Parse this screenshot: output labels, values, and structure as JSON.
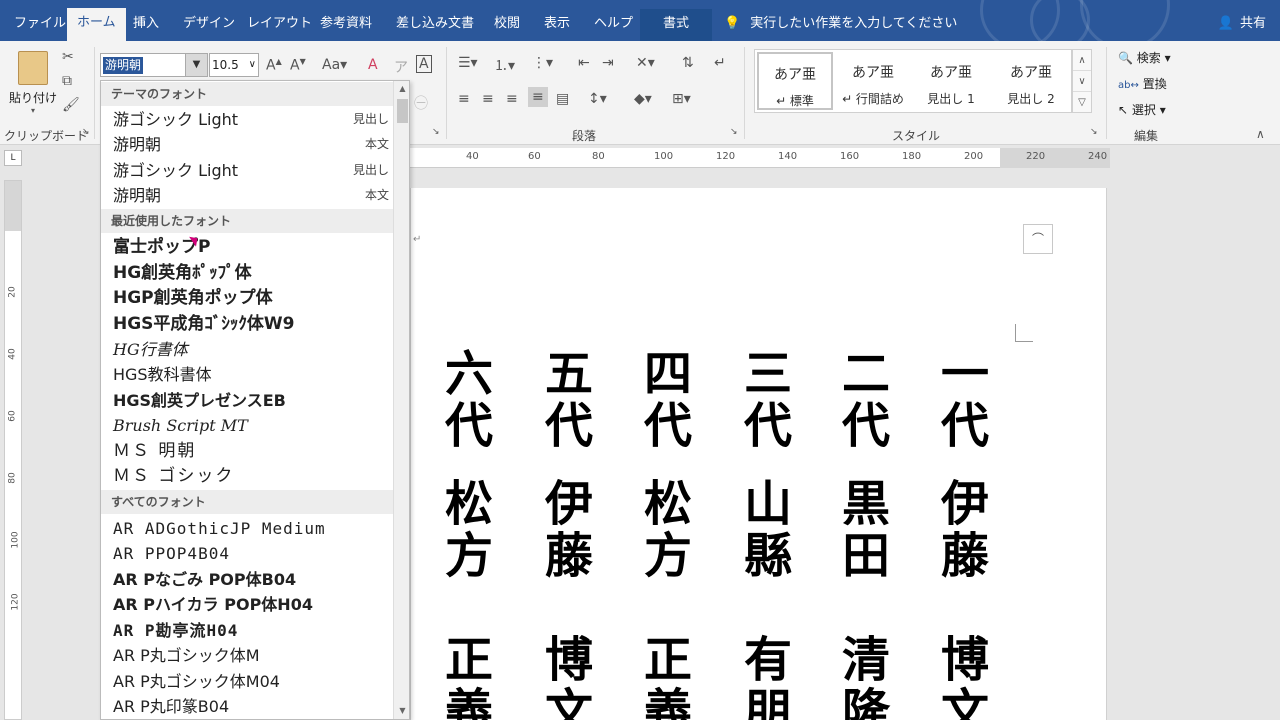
{
  "tabs": [
    "ファイル",
    "ホーム",
    "挿入",
    "デザイン",
    "レイアウト",
    "参考資料",
    "差し込み文書",
    "校閲",
    "表示",
    "ヘルプ",
    "書式"
  ],
  "tell_me": "実行したい作業を入力してください",
  "share": "共有",
  "ribbon": {
    "paste": "貼り付け",
    "clipboard_label": "クリップボード",
    "font_name": "游明朝",
    "font_size": "10.5",
    "paragraph_label": "段落",
    "styles_label": "スタイル",
    "styles": [
      {
        "sample": "あア亜",
        "name": "↵ 標準"
      },
      {
        "sample": "あア亜",
        "name": "↵ 行間詰め"
      },
      {
        "sample": "あア亜",
        "name": "見出し 1"
      },
      {
        "sample": "あア亜",
        "name": "見出し 2"
      }
    ],
    "edit_label": "編集",
    "find": "検索",
    "replace": "置換",
    "select": "選択"
  },
  "ruler": [
    "40",
    "60",
    "80",
    "100",
    "120",
    "140",
    "160",
    "180",
    "200",
    "220",
    "240"
  ],
  "vruler": [
    "20",
    "40",
    "60",
    "80",
    "100",
    "120"
  ],
  "font_dropdown": {
    "theme_header": "テーマのフォント",
    "theme_fonts": [
      {
        "name": "游ゴシック Light",
        "tag": "見出し"
      },
      {
        "name": "游明朝",
        "tag": "本文"
      },
      {
        "name": "游ゴシック Light",
        "tag": "見出し"
      },
      {
        "name": "游明朝",
        "tag": "本文"
      }
    ],
    "recent_header": "最近使用したフォント",
    "recent_fonts": [
      "富士ポップP",
      "HG創英角ﾎﾟｯﾌﾟ体",
      "HGP創英角ポップ体",
      "HGS平成角ｺﾞｼｯｸ体W9",
      "HG行書体",
      "HGS教科書体",
      "HGS創英プレゼンスEB",
      "Brush Script MT",
      "ＭＳ 明朝",
      "ＭＳ ゴシック"
    ],
    "all_header": "すべてのフォント",
    "all_fonts": [
      "AR ADGothicJP Medium",
      "AR PPOP4B04",
      "AR Pなごみ POP体B04",
      "AR Pハイカラ POP体H04",
      "AR P勘亭流H04",
      "AR P丸ゴシック体M",
      "AR P丸ゴシック体M04",
      "AR P丸印篆B04"
    ]
  },
  "document": {
    "para_mark": "↵",
    "columns": [
      {
        "gen": "六代",
        "name": "松方",
        "given": "正義"
      },
      {
        "gen": "五代",
        "name": "伊藤",
        "given": "博文"
      },
      {
        "gen": "四代",
        "name": "松方",
        "given": "正義"
      },
      {
        "gen": "三代",
        "name": "山縣",
        "given": "有朋"
      },
      {
        "gen": "二代",
        "name": "黒田",
        "given": "清隆"
      },
      {
        "gen": "一代",
        "name": "伊藤",
        "given": "博文"
      }
    ]
  }
}
